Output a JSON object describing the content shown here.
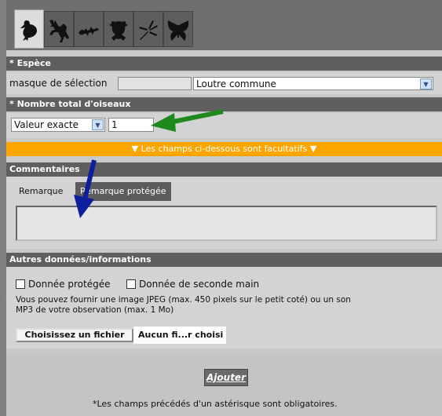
{
  "tabs": [
    {
      "icon": "bird-icon"
    },
    {
      "icon": "deer-icon"
    },
    {
      "icon": "lizard-icon"
    },
    {
      "icon": "frog-icon"
    },
    {
      "icon": "dragonfly-icon"
    },
    {
      "icon": "butterfly-icon"
    }
  ],
  "species": {
    "header": "* Espèce",
    "mask_label": "masque de sélection",
    "mask_value": "",
    "selected": "Loutre commune"
  },
  "count": {
    "header": "* Nombre total d'oiseaux",
    "mode": "Valeur exacte",
    "value": "1"
  },
  "optional_banner": "▼  Les champs ci-dessous sont facultatifs  ▼",
  "comments": {
    "header": "Commentaires",
    "tab_remark": "Remarque",
    "tab_protected": "Remarque protégée",
    "text": ""
  },
  "other": {
    "header": "Autres données/informations",
    "protected_label": "Donnée protégée",
    "second_hand_label": "Donnée de seconde main",
    "info_line1": "Vous pouvez fournir une image JPEG (max. 450 pixels sur le petit coté) ou un son",
    "info_line2": "MP3 de votre observation (max. 1 Mo)",
    "file_button": "Choisissez un fichier",
    "file_status": "Aucun fi...r choisi"
  },
  "add_button": "Ajouter",
  "footnote": "*Les champs précédés d'un astérisque sont obligatoires.",
  "colors": {
    "banner": "#ffa500",
    "header": "#5f5f5f",
    "arrow_green": "#1e8a1e",
    "arrow_blue": "#0c1f9c"
  }
}
